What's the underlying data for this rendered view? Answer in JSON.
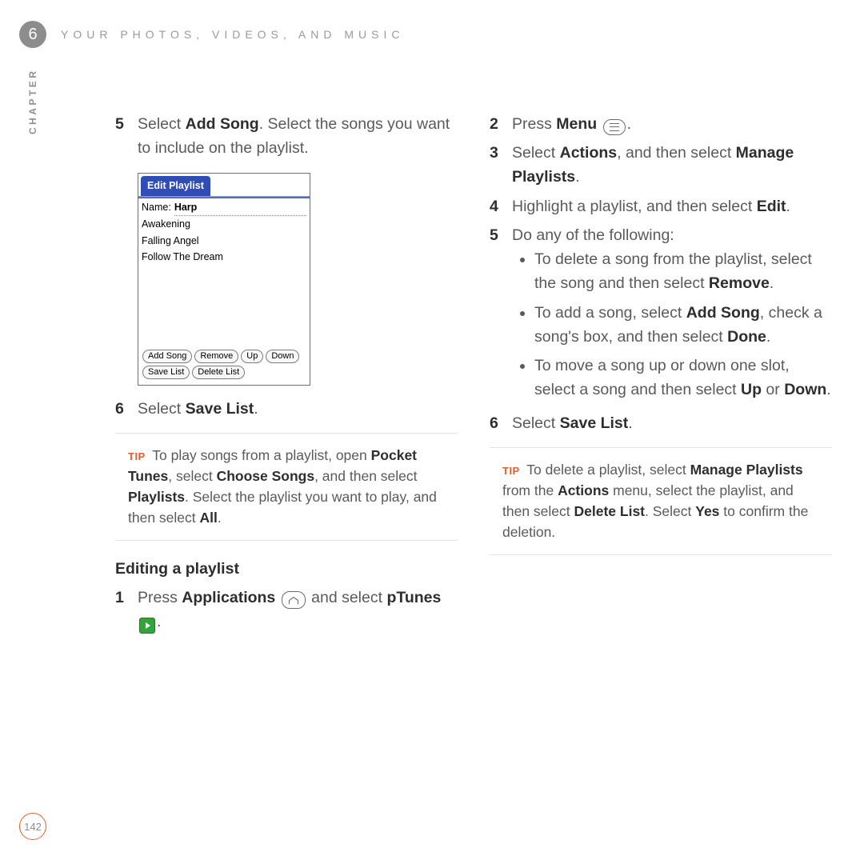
{
  "chapter": {
    "number": "6",
    "header": "YOUR PHOTOS, VIDEOS, AND MUSIC",
    "side_label": "CHAPTER"
  },
  "page_number": "142",
  "colors": {
    "accent": "#e65c2e",
    "screen_blue": "#2f4db3"
  },
  "left": {
    "step5_num": "5",
    "step5_pre": "Select ",
    "step5_bold": "Add Song",
    "step5_post": ". Select the songs you want to include on the playlist.",
    "screen": {
      "tab": "Edit Playlist",
      "name_label": "Name:",
      "name_value": "Harp",
      "songs": [
        "Awakening",
        "Falling Angel",
        "Follow The Dream"
      ],
      "buttons_row1": [
        "Add Song",
        "Remove",
        "Up",
        "Down"
      ],
      "buttons_row2": [
        "Save List",
        "Delete List"
      ]
    },
    "step6_num": "6",
    "step6_pre": "Select ",
    "step6_bold": "Save List",
    "step6_post": ".",
    "tip_label": "TIP",
    "tip_parts": {
      "p1": "To play songs from a playlist, open ",
      "b1": "Pocket Tunes",
      "p2": ", select ",
      "b2": "Choose Songs",
      "p3": ", and then select ",
      "b3": "Playlists",
      "p4": ". Select the playlist you want to play, and then select ",
      "b4": "All",
      "p5": "."
    },
    "subhead": "Editing a playlist",
    "ed_step1_num": "1",
    "ed_step1_pre": "Press ",
    "ed_step1_bold1": "Applications",
    "ed_step1_mid": " and select ",
    "ed_step1_bold2": "pTunes",
    "ed_step1_post": " ."
  },
  "right": {
    "s2_num": "2",
    "s2_pre": "Press ",
    "s2_bold": "Menu",
    "s2_post": " .",
    "s3_num": "3",
    "s3_pre": "Select ",
    "s3_b1": "Actions",
    "s3_mid": ", and then select ",
    "s3_b2": "Manage Playlists",
    "s3_post": ".",
    "s4_num": "4",
    "s4_pre": "Highlight a playlist, and then select ",
    "s4_bold": "Edit",
    "s4_post": ".",
    "s5_num": "5",
    "s5_text": "Do any of the following:",
    "b_remove_pre": "To delete a song from the playlist, select the song and then select ",
    "b_remove_bold": "Remove",
    "b_remove_post": ".",
    "b_add_pre": "To add a song, select ",
    "b_add_b1": "Add Song",
    "b_add_mid": ", check a song's box, and then select ",
    "b_add_b2": "Done",
    "b_add_post": ".",
    "b_move_pre": "To move a song up or down one slot, select a song and then select ",
    "b_move_b1": "Up",
    "b_move_mid": " or ",
    "b_move_b2": "Down",
    "b_move_post": ".",
    "s6_num": "6",
    "s6_pre": "Select ",
    "s6_bold": "Save List",
    "s6_post": ".",
    "tip_label": "TIP",
    "tip2": {
      "p1": "To delete a playlist, select ",
      "b1": "Manage Playlists",
      "p2": " from the ",
      "b2": "Actions",
      "p3": " menu, select the playlist, and then select ",
      "b3": "Delete List",
      "p4": ". Select ",
      "b4": "Yes",
      "p5": " to confirm the deletion."
    }
  }
}
